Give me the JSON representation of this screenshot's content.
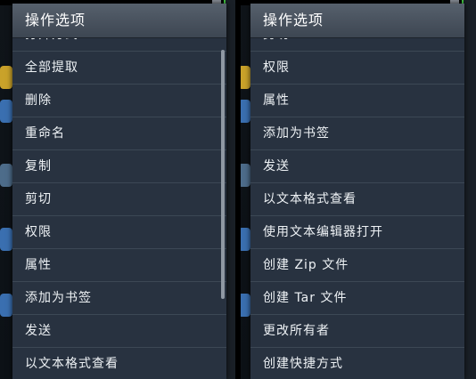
{
  "left_panel": {
    "menu_title": "操作选项",
    "items": [
      {
        "label": "打开方式"
      },
      {
        "label": "全部提取"
      },
      {
        "label": "删除"
      },
      {
        "label": "重命名"
      },
      {
        "label": "复制"
      },
      {
        "label": "剪切"
      },
      {
        "label": "权限"
      },
      {
        "label": "属性"
      },
      {
        "label": "添加为书签"
      },
      {
        "label": "发送"
      },
      {
        "label": "以文本格式查看"
      }
    ]
  },
  "right_panel": {
    "menu_title": "操作选项",
    "items": [
      {
        "label": "剪切"
      },
      {
        "label": "权限"
      },
      {
        "label": "属性"
      },
      {
        "label": "添加为书签"
      },
      {
        "label": "发送"
      },
      {
        "label": "以文本格式查看"
      },
      {
        "label": "使用文本编辑器打开"
      },
      {
        "label": "创建 Zip 文件"
      },
      {
        "label": "创建 Tar 文件"
      },
      {
        "label": "更改所有者"
      },
      {
        "label": "创建快捷方式"
      }
    ]
  },
  "colors": {
    "menu_bg": "#283240",
    "title_bg": "#4a5360",
    "text": "#eef2f5",
    "battery": "#43c843"
  },
  "icons": [
    "signal-icon",
    "battery-icon",
    "folder-icon"
  ]
}
